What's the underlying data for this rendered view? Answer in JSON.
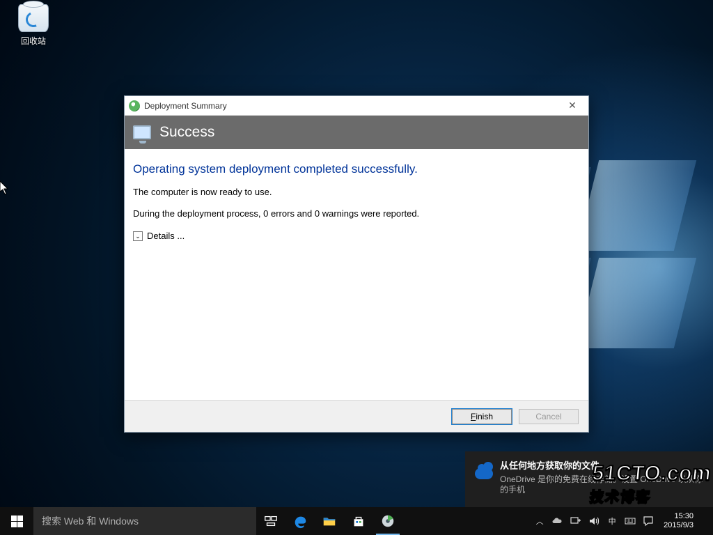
{
  "desktop": {
    "recycle_bin_label": "回收站"
  },
  "dialog": {
    "title": "Deployment Summary",
    "banner": "Success",
    "heading": "Operating system deployment completed successfully.",
    "line1": "The computer is now ready to use.",
    "line2": "During the deployment process, 0 errors and 0 warnings were reported.",
    "details_label": "Details ...",
    "finish_label": "Finish",
    "finish_accel_char": "F",
    "cancel_label": "Cancel"
  },
  "toast": {
    "title": "从任何地方获取你的文件",
    "body": "OneDrive 是你的免费在线存储。设置 OneDrive 以从你的手机"
  },
  "taskbar": {
    "search_placeholder": "搜索 Web 和 Windows"
  },
  "systray": {
    "time": "15:30",
    "date": "2015/9/3"
  },
  "watermark": {
    "line1": "51CTO.com",
    "line2": "技术博客"
  }
}
